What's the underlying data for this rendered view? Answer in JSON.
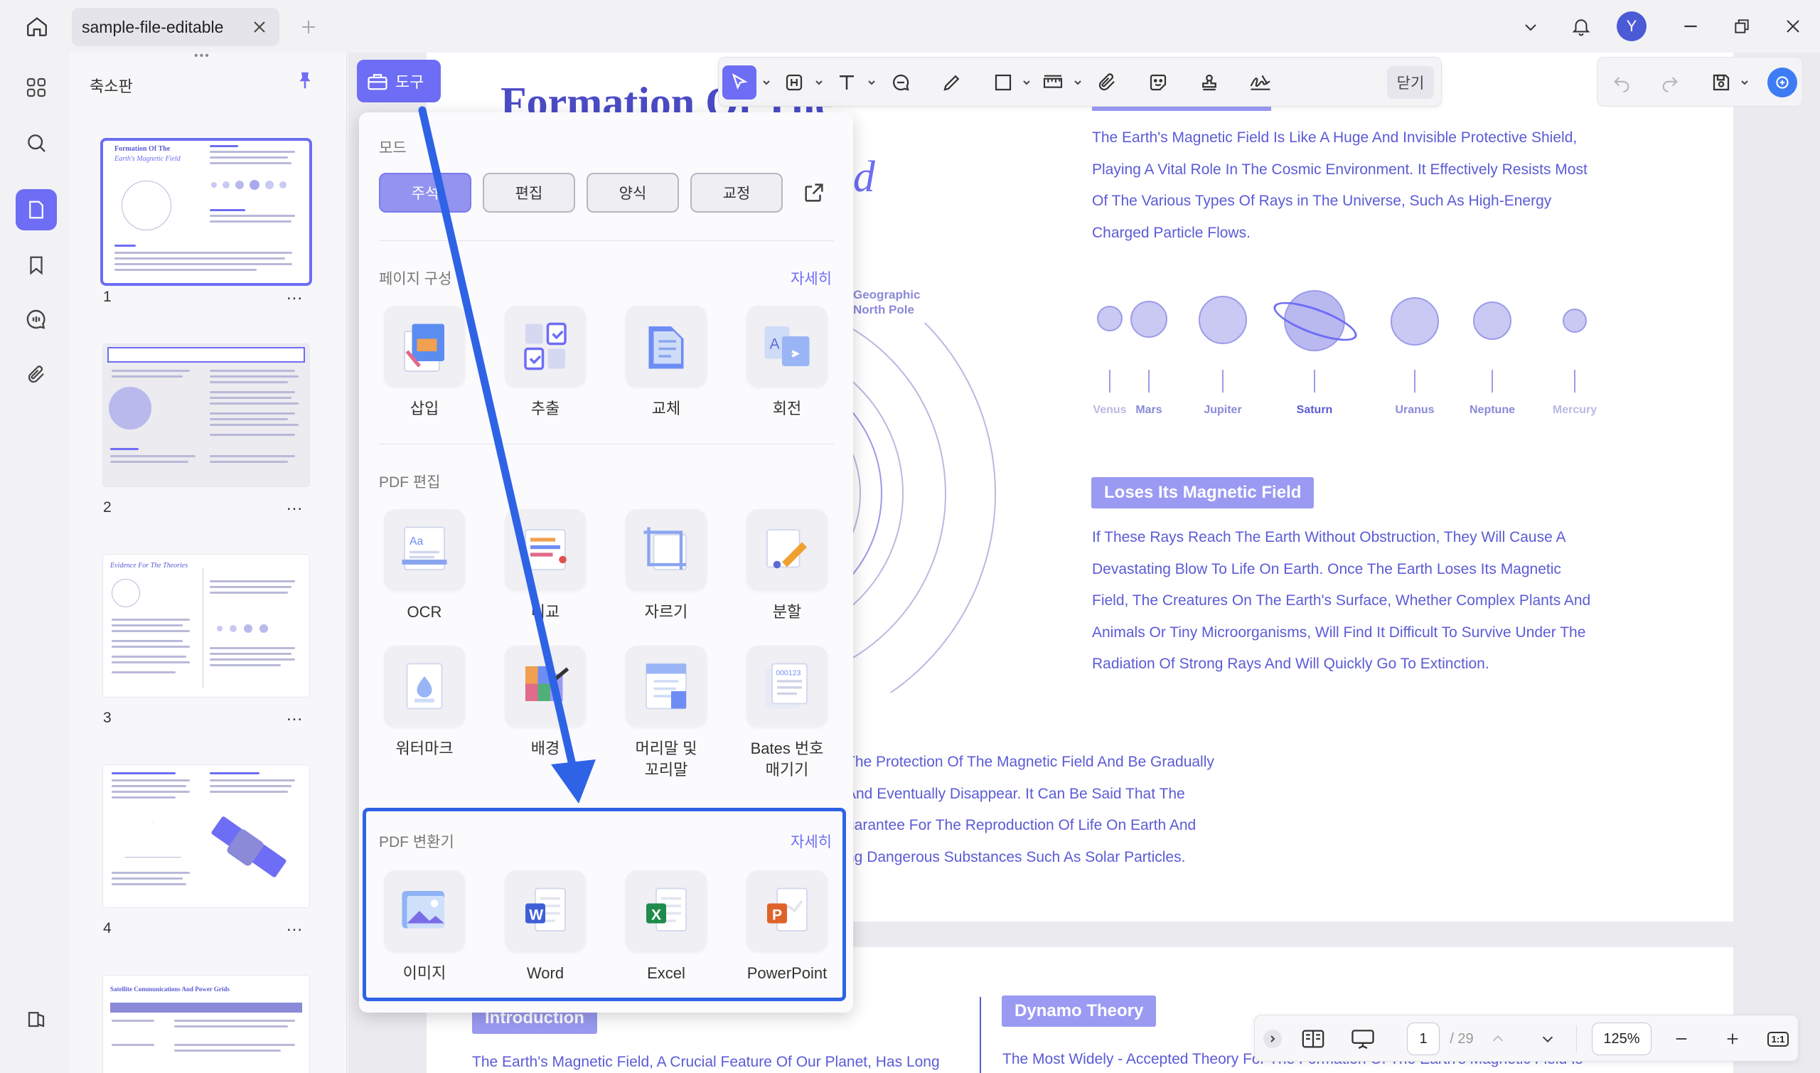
{
  "tab": {
    "title": "sample-file-editable"
  },
  "user": {
    "initial": "Y"
  },
  "thumbnails": {
    "title": "축소판",
    "pages": [
      "1",
      "2",
      "3",
      "4"
    ],
    "more": "...",
    "thumb_titles": [
      "Formation Of The",
      "Earth's Magnetic Field",
      "Evidence For The Theories",
      "Satellite Communications And Power Grids"
    ]
  },
  "toolbar": {
    "close_label": "닫기"
  },
  "tool_button": {
    "label": "도구"
  },
  "panel": {
    "mode_label": "모드",
    "modes": [
      "주석",
      "편집",
      "양식",
      "교정"
    ],
    "page_section": "페이지 구성",
    "page_more": "자세히",
    "page_tools": [
      "삽입",
      "추출",
      "교체",
      "회전"
    ],
    "edit_section": "PDF 편집",
    "edit_tools": [
      "OCR",
      "비교",
      "자르기",
      "분할"
    ],
    "edit_tools2": [
      "워터마크",
      "배경",
      "머리말 및\n꼬리말",
      "Bates 번호\n매기기"
    ],
    "convert_section": "PDF 변환기",
    "convert_more": "자세히",
    "convert_tools": [
      "이미지",
      "Word",
      "Excel",
      "PowerPoint"
    ]
  },
  "document": {
    "title_line1": "Formation Of The",
    "title_line2": "Field",
    "geo_label": "Geographic\nNorth Pole",
    "intro_text": [
      "The Earth's Magnetic Field Is Like A Huge And Invisible Protective Shield,",
      "Playing A Vital Role In The Cosmic Environment. It Effectively Resists Most",
      "Of The Various Types Of Rays in The Universe, Such As High-Energy",
      "Charged Particle Flows."
    ],
    "planets": [
      "Venus",
      "Mars",
      "Jupiter",
      "Saturn",
      "Uranus",
      "Neptune",
      "Mercury"
    ],
    "loses_heading": "Loses Its Magnetic Field",
    "loses_text": [
      "If These Rays Reach The Earth Without Obstruction, They Will Cause A",
      "Devastating Blow To Life On Earth. Once The Earth Loses Its Magnetic",
      "Field, The Creatures On The Earth's Surface, Whether Complex Plants And",
      "Animals Or Tiny Microorganisms, Will Find It Difficult To Survive Under The",
      "Radiation Of Strong Rays And Will Quickly Go To Extinction."
    ],
    "lower_text": [
      "The Protection Of The Magnetic Field And Be Gradually",
      "And Eventually Disappear. It Can Be Said That The",
      "uarantee For The Reproduction Of Life On Earth And",
      "ng Dangerous Substances Such As Solar Particles."
    ],
    "intro_heading": "Introduction",
    "dynamo_heading": "Dynamo Theory",
    "bottom_left_text": "The Earth's Magnetic Field, A Crucial Feature Of Our Planet, Has Long",
    "bottom_right_text": "The Most Widely - Accepted Theory For The Formation Of The Earth's Magnetic Field Is"
  },
  "bottombar": {
    "page_current": "1",
    "page_total": "/ 29",
    "zoom": "125%",
    "fit": "1:1"
  },
  "colors": {
    "accent": "#6d6df5",
    "highlight_box": "#2f63e6",
    "doc_text": "#5b5bd6"
  }
}
